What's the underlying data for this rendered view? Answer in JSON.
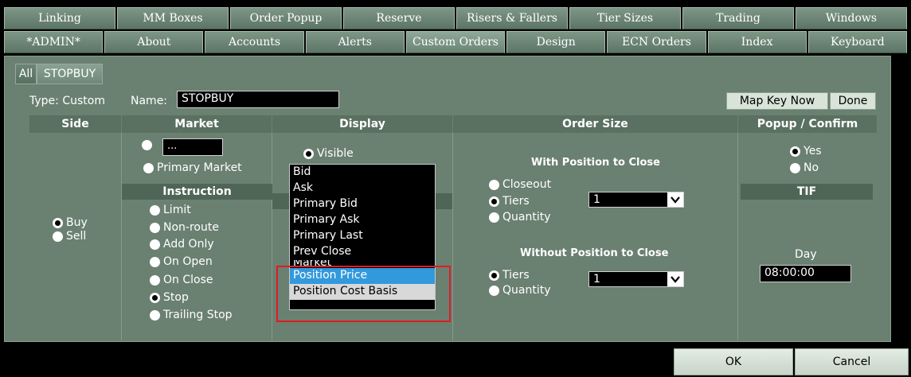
{
  "tabs_row1": [
    "Linking",
    "MM Boxes",
    "Order Popup",
    "Reserve",
    "Risers & Fallers",
    "Tier Sizes",
    "Trading",
    "Windows"
  ],
  "tabs_row2": [
    "*ADMIN*",
    "About",
    "Accounts",
    "Alerts",
    "Custom Orders",
    "Design",
    "ECN Orders",
    "Index",
    "Keyboard"
  ],
  "subtabs": [
    "All",
    "STOPBUY"
  ],
  "type_label": "Type: Custom",
  "name_label": "Name:",
  "name_value": "STOPBUY",
  "map_key_button": "Map Key Now",
  "done_button": "Done",
  "headers": {
    "side": "Side",
    "market": "Market",
    "display": "Display",
    "order_size": "Order Size",
    "popup": "Popup / Confirm"
  },
  "side": {
    "buy": "Buy",
    "sell": "Sell"
  },
  "market": {
    "field_value": "...",
    "primary_market": "Primary Market",
    "instruction_header": "Instruction",
    "instructions": [
      "Limit",
      "Non-route",
      "Add Only",
      "On Open",
      "On Close",
      "Stop",
      "Trailing Stop"
    ],
    "selected_instruction": "Stop"
  },
  "display": {
    "visible": "Visible",
    "dropdown_items": [
      "Bid",
      "Ask",
      "Primary Bid",
      "Primary Ask",
      "Primary Last",
      "Prev Close",
      "Market",
      "Position Price",
      "Position Cost Basis"
    ],
    "highlighted": "Position Price"
  },
  "order_size": {
    "with_title": "With Position to Close",
    "with_options": [
      "Closeout",
      "Tiers",
      "Quantity"
    ],
    "with_value": "1",
    "without_title": "Without Position to Close",
    "without_options": [
      "Tiers",
      "Quantity"
    ],
    "without_value": "1"
  },
  "popup": {
    "yes": "Yes",
    "no": "No",
    "tif_header": "TIF",
    "tif_value": "Day",
    "time_value": "08:00:00"
  },
  "ok_button": "OK",
  "cancel_button": "Cancel",
  "colors": {
    "highlight": "#3399dd",
    "callout": "#e01b24",
    "panel": "#6a8071"
  }
}
